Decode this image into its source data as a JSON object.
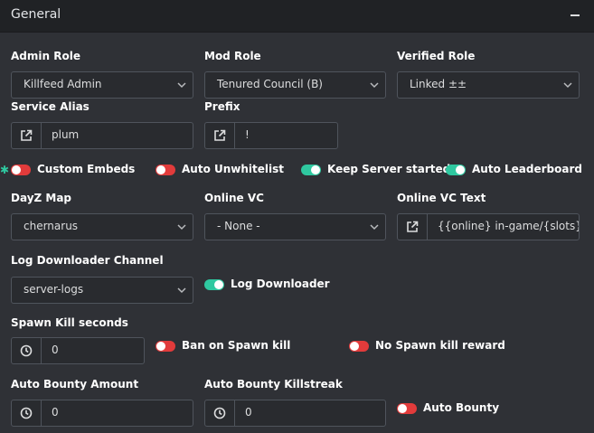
{
  "header": {
    "title": "General"
  },
  "admin_role": {
    "label": "Admin Role",
    "value": "Killfeed Admin"
  },
  "mod_role": {
    "label": "Mod Role",
    "value": "Tenured Council (B)"
  },
  "verified_role": {
    "label": "Verified Role",
    "value": "Linked ±±"
  },
  "service_alias": {
    "label": "Service Alias",
    "value": "plum"
  },
  "prefix": {
    "label": "Prefix",
    "value": "!"
  },
  "toggles_row1": [
    {
      "label": "Custom Embeds",
      "on": false
    },
    {
      "label": "Auto Unwhitelist",
      "on": false
    },
    {
      "label": "Keep Server started",
      "on": true
    },
    {
      "label": "Auto Leaderboard",
      "on": true
    }
  ],
  "dayz_map": {
    "label": "DayZ Map",
    "value": "chernarus"
  },
  "online_vc": {
    "label": "Online VC",
    "value": "- None -"
  },
  "online_vc_text": {
    "label": "Online VC Text",
    "value": "{{online} in-game/{slots} slo"
  },
  "log_channel": {
    "label": "Log Downloader Channel",
    "value": "server-logs"
  },
  "log_downloader": {
    "label": "Log Downloader",
    "on": true
  },
  "spawn_kill": {
    "label": "Spawn Kill seconds",
    "value": "0"
  },
  "ban_spawn_kill": {
    "label": "Ban on Spawn kill",
    "on": false
  },
  "no_spawn_reward": {
    "label": "No Spawn kill reward",
    "on": false
  },
  "bounty_amount": {
    "label": "Auto Bounty Amount",
    "value": "0"
  },
  "bounty_killstreak": {
    "label": "Auto Bounty Killstreak",
    "value": "0"
  },
  "auto_bounty": {
    "label": "Auto Bounty",
    "on": false
  },
  "colors": {
    "header_bg": "#202225",
    "panel_bg": "#2f3136",
    "toggle_on": "#2fc8a0",
    "toggle_off": "#e23b3b"
  }
}
